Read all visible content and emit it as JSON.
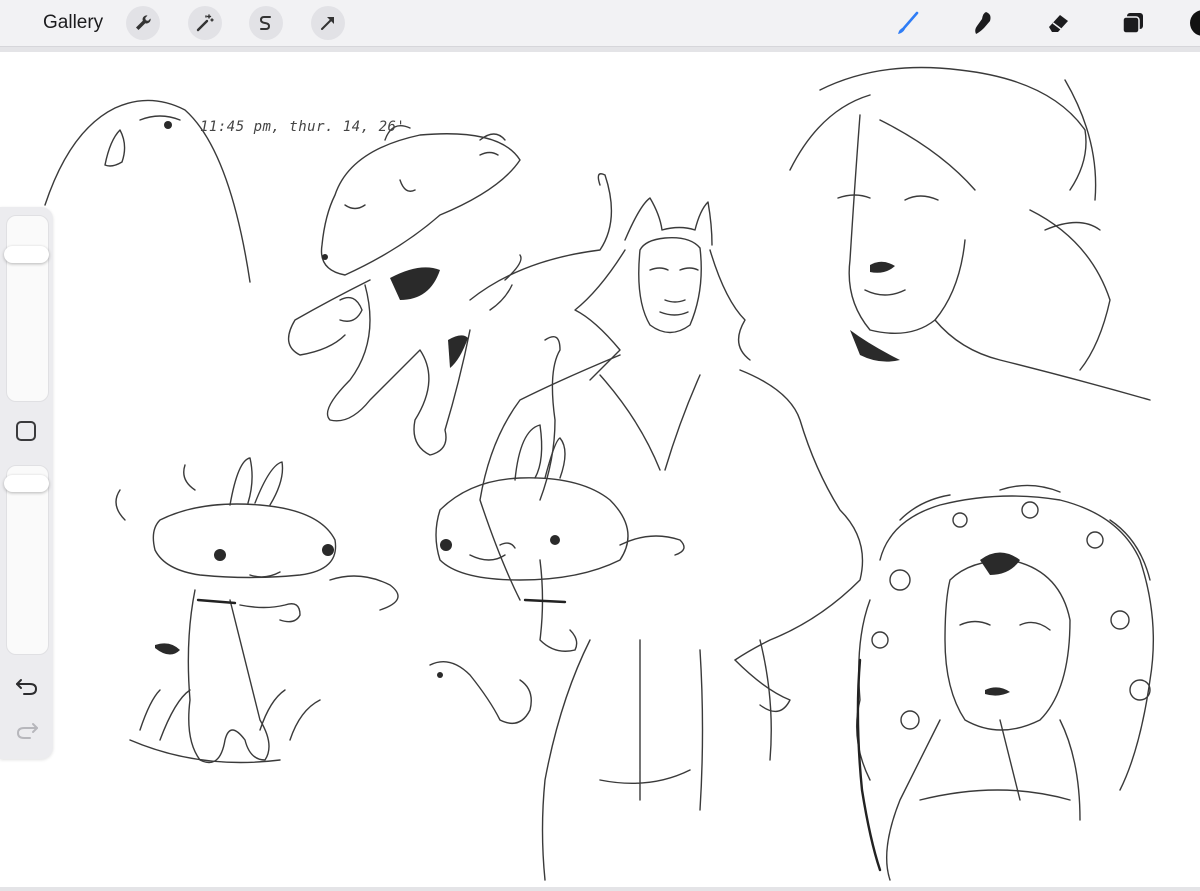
{
  "app": {
    "gallery_label": "Gallery"
  },
  "toolbar_left": [
    {
      "name": "actions-wrench-icon"
    },
    {
      "name": "adjustments-magic-wand-icon"
    },
    {
      "name": "selection-s-icon"
    },
    {
      "name": "transform-arrow-icon"
    }
  ],
  "toolbar_right": [
    {
      "name": "brush-icon",
      "active": true,
      "color": "#2f7df6"
    },
    {
      "name": "smudge-icon",
      "active": false
    },
    {
      "name": "eraser-icon",
      "active": false
    },
    {
      "name": "layers-icon",
      "active": false
    },
    {
      "name": "color-swatch-icon",
      "color": "#111111"
    }
  ],
  "canvas": {
    "timestamp_text": "11:45 pm, thur. 14, 26'",
    "background": "#ffffff"
  },
  "sidebar": {
    "brush_size_level": 0.82,
    "opacity_level": 0.95,
    "icons": [
      "modify-square-icon",
      "undo-icon",
      "redo-icon"
    ]
  },
  "colors": {
    "accent": "#2f7df6",
    "toolbar_bg": "#f2f2f4",
    "ink": "#222222"
  }
}
